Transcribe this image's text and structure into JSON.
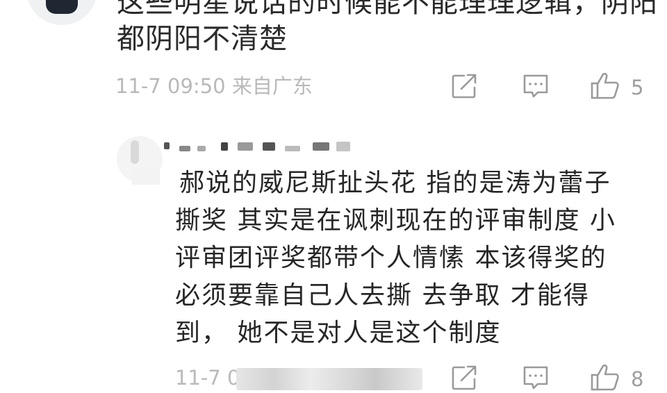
{
  "top_comment": {
    "text_line1": "这些明星说话的时候能不能理理逻辑，阴阳",
    "text_line2": "都阴阳不清楚",
    "date": "11-7 09:50",
    "location": "来自广东",
    "like_count": "5",
    "icons": [
      "share-icon",
      "comment-icon",
      "thumbs-up-icon"
    ]
  },
  "reply": {
    "lines": [
      "郝说的威尼斯扯头花 指的是涛为蕾子",
      "撕奖 其实是在讽刺现在的评审制度 小",
      "评审团评奖都带个人情愫 本该得奖的",
      "必须要靠自己人去撕 去争取 才能得",
      "到， 她不是对人是这个制度"
    ],
    "date_visible": "11-7 0",
    "like_count": "8",
    "icons": [
      "share-icon",
      "comment-icon",
      "thumbs-up-icon"
    ]
  },
  "colors": {
    "text": "#2a2a2a",
    "meta": "#b9b9b9",
    "icon": "#9a9a9a",
    "background": "#ffffff"
  }
}
